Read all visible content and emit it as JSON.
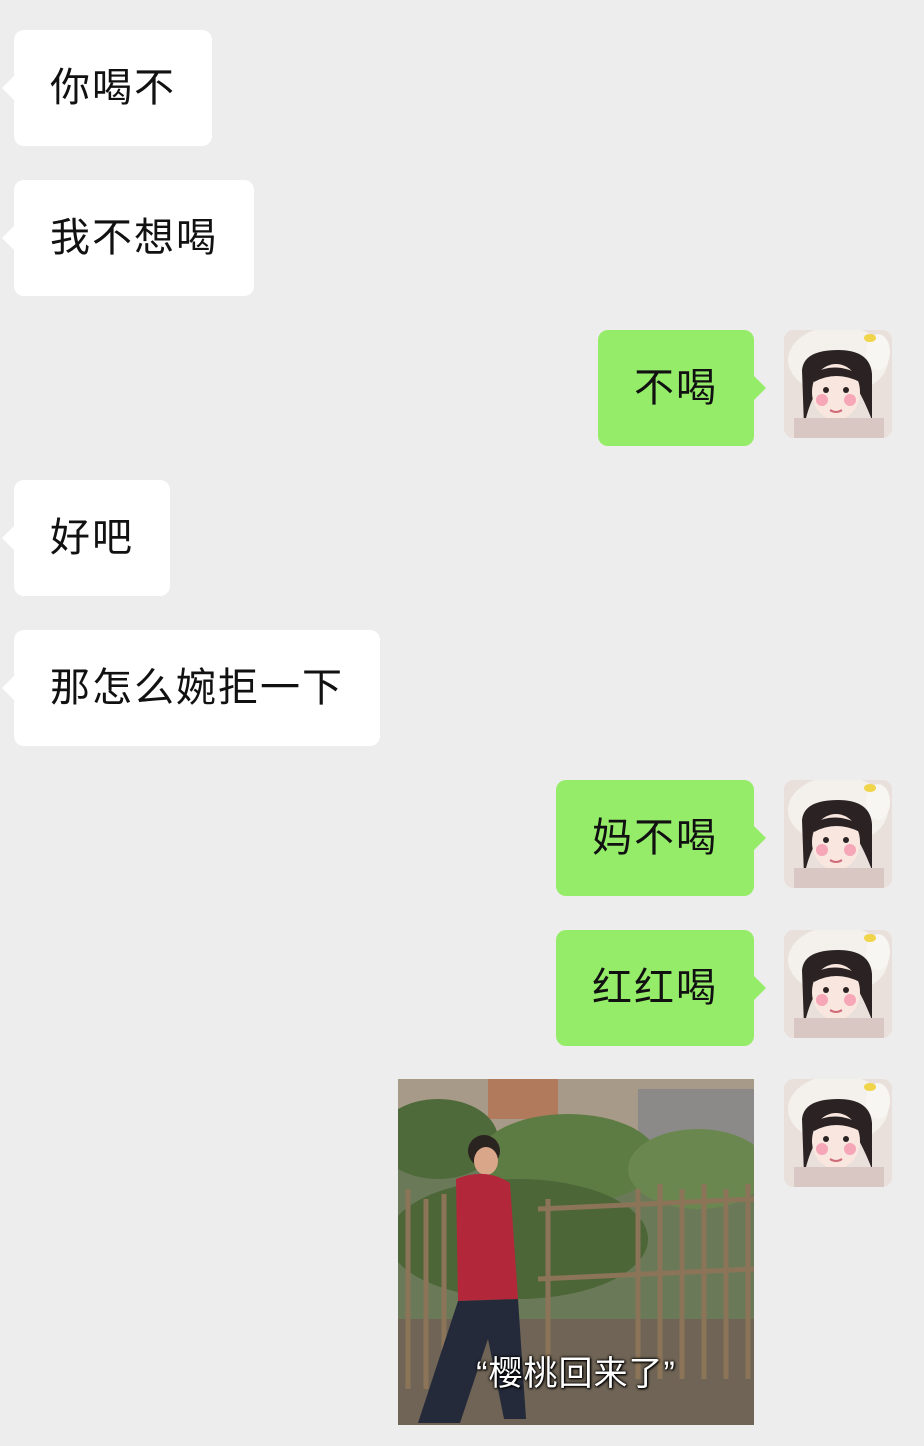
{
  "messages": [
    {
      "side": "in",
      "text": "你喝不"
    },
    {
      "side": "in",
      "text": "我不想喝"
    },
    {
      "side": "out",
      "text": "不喝"
    },
    {
      "side": "in",
      "text": "好吧"
    },
    {
      "side": "in",
      "text": "那怎么婉拒一下"
    },
    {
      "side": "out",
      "text": "妈不喝"
    },
    {
      "side": "out",
      "text": "红红喝"
    },
    {
      "side": "out",
      "type": "image",
      "image_caption": "“樱桃回来了”"
    }
  ],
  "colors": {
    "background": "#ededed",
    "incoming_bubble": "#ffffff",
    "outgoing_bubble": "#95ec69",
    "text": "#111111"
  },
  "avatar_icon": "girl-with-bunny-hat-avatar"
}
